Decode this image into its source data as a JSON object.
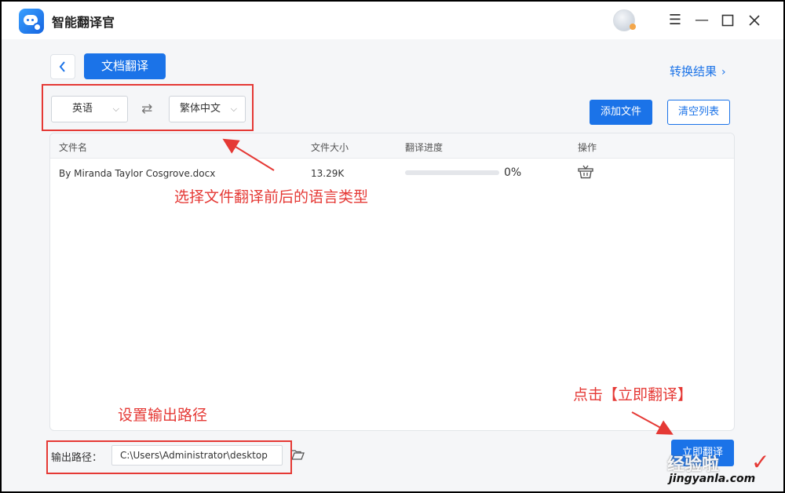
{
  "app": {
    "title": "智能翻译官",
    "window_controls": [
      "menu-icon",
      "minimize-icon",
      "maximize-icon",
      "close-icon"
    ]
  },
  "nav": {
    "back_icon": "chevron-left-icon",
    "active_tab": "文档翻译",
    "result_link": "转换结果",
    "result_chevron": "›"
  },
  "language": {
    "source": "英语",
    "target": "繁体中文",
    "swap_icon": "swap-icon"
  },
  "actions": {
    "add_file": "添加文件",
    "clear_list": "清空列表",
    "translate_now": "立即翻译"
  },
  "table": {
    "headers": {
      "name": "文件名",
      "size": "文件大小",
      "progress": "翻译进度",
      "operation": "操作"
    },
    "rows": [
      {
        "name": "By Miranda Taylor Cosgrove.docx",
        "size": "13.29K",
        "progress_label": "0%",
        "progress": 0
      }
    ]
  },
  "output": {
    "label": "输出路径：",
    "path": "C:\\Users\\Administrator\\desktop",
    "folder_icon": "folder-open-icon"
  },
  "annotations": {
    "language_note": "选择文件翻译前后的语言类型",
    "path_note": "设置输出路径",
    "click_note": "点击【立即翻译】",
    "color": "#e53935"
  },
  "watermark": {
    "main": "经验啦",
    "sub": "jingyanla.com",
    "check": "✓"
  },
  "colors": {
    "accent": "#1b73e8",
    "annotation": "#e53935"
  }
}
